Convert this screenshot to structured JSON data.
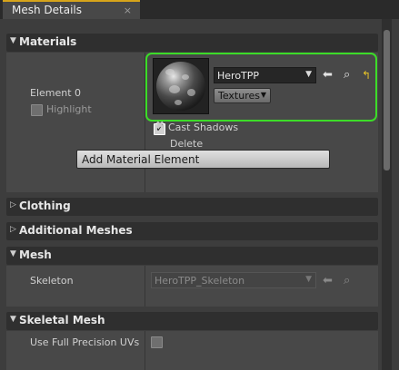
{
  "tab": {
    "label": "Mesh Details",
    "close_glyph": "×"
  },
  "sections": {
    "materials": {
      "title": "Materials",
      "element_label": "Element 0",
      "highlight_label": "Highlight",
      "material_name": "HeroTPP",
      "textures_label": "Textures",
      "cast_shadows_label": "Cast Shadows",
      "cast_shadows_checked": true,
      "delete_label": "Delete",
      "add_element_label": "Add Material Element",
      "highlight_color": "#3cdc28"
    },
    "clothing": {
      "title": "Clothing"
    },
    "additional_meshes": {
      "title": "Additional Meshes"
    },
    "mesh": {
      "title": "Mesh",
      "skeleton_label": "Skeleton",
      "skeleton_value": "HeroTPP_Skeleton"
    },
    "skeletal_mesh": {
      "title": "Skeletal Mesh",
      "full_precision_label": "Use Full Precision UVs",
      "full_precision_checked": false
    }
  },
  "icons": {
    "expanded": "▼",
    "collapsed": "▷",
    "use_selected": "arrow-left-icon",
    "browse": "search-icon",
    "reset": "reset-arrow-icon"
  },
  "colors": {
    "accent_tab": "#d7a41a",
    "selection_outline": "#3cdc28"
  }
}
